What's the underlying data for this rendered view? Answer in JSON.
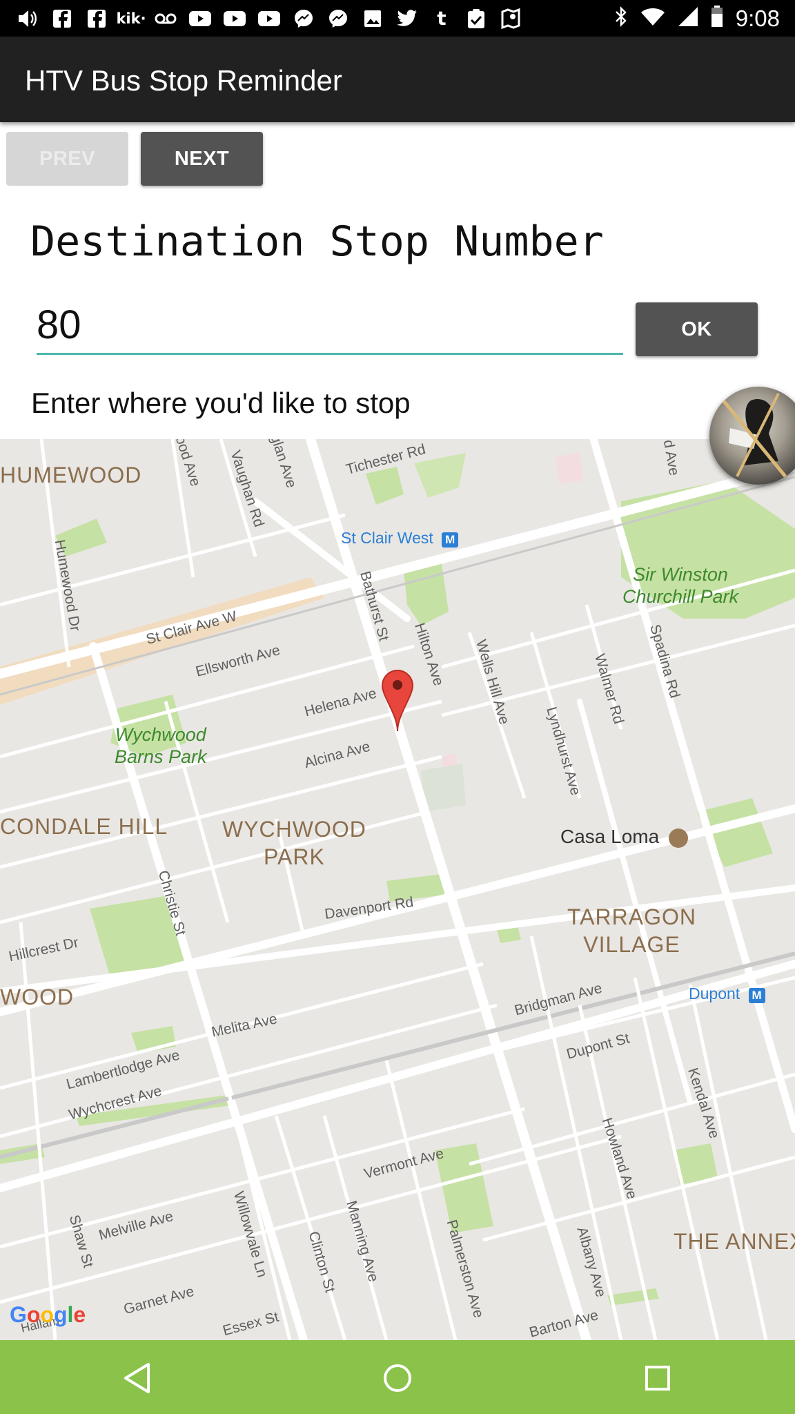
{
  "status_bar": {
    "time": "9:08",
    "left_icons": [
      "volume-icon",
      "facebook-icon",
      "facebook-icon",
      "kik-icon",
      "voicemail-icon",
      "youtube-icon",
      "youtube-icon",
      "youtube-icon",
      "messenger-icon",
      "messenger-icon",
      "photo-icon",
      "twitter-icon",
      "tumblr-icon",
      "clipboard-check-icon",
      "maps-icon"
    ],
    "right_icons": [
      "bluetooth-icon",
      "wifi-icon",
      "signal-icon",
      "battery-icon"
    ]
  },
  "app_bar": {
    "title": "HTV Bus Stop Reminder"
  },
  "controls": {
    "prev_label": "PREV",
    "next_label": "NEXT",
    "destination_title": "Destination Stop Number",
    "stop_input_value": "80",
    "ok_label": "OK",
    "hint": "Enter where you'd like to stop"
  },
  "map": {
    "areas": {
      "humewood": "HUMEWOOD",
      "wychwood_park": "WYCHWOOD\nPARK",
      "cedarvale_hill": "CONDALE HILL",
      "hillcrest": "WOOD",
      "tarragon": "TARRAGON\nVILLAGE",
      "annex": "THE ANNEX"
    },
    "parks": {
      "churchill": "Sir Winston\nChurchill Park",
      "wychwood_barns": "Wychwood\nBarns Park"
    },
    "transit": {
      "st_clair_west": "St Clair West",
      "dupont": "Dupont"
    },
    "poi": {
      "casa_loma": "Casa Loma"
    },
    "streets": {
      "tichester": "Tichester Rd",
      "vaughan": "Vaughan Rd",
      "glan": "glan Ave",
      "ood": "ood Ave",
      "humewood_dr": "Humewood Dr",
      "st_clair": "St Clair Ave W",
      "ellsworth": "Ellsworth Ave",
      "bathurst": "Bathurst St",
      "hilton": "Hilton Ave",
      "wells_hill": "Wells Hill Ave",
      "walmer": "Walmer Rd",
      "spadina": "Spadina Rd",
      "d_ave": "d Ave",
      "lyndhurst": "Lyndhurst Ave",
      "helena": "Helena Ave",
      "alcina": "Alcina Ave",
      "christie": "Christie St",
      "davenport": "Davenport Rd",
      "hillcrest_dr": "Hillcrest Dr",
      "melita": "Melita Ave",
      "bridgman": "Bridgman Ave",
      "dupont_st": "Dupont St",
      "kendal": "Kendal Ave",
      "lambertlodge": "Lambertlodge Ave",
      "wychcrest": "Wychcrest Ave",
      "howland": "Howland Ave",
      "vermont": "Vermont Ave",
      "melville": "Melville Ave",
      "shaw": "Shaw St",
      "willowvale": "Willowvale Ln",
      "clinton": "Clinton St",
      "manning": "Manning Ave",
      "palmerston": "Palmerston Ave",
      "albany": "Albany Ave",
      "garnet": "Garnet Ave",
      "essex": "Essex St",
      "barton": "Barton Ave",
      "hallam": "Hallam"
    },
    "attribution": "Google"
  },
  "nav_bar": {
    "back_icon": "back-triangle-icon",
    "home_icon": "home-circle-icon",
    "recents_icon": "recents-square-icon"
  }
}
